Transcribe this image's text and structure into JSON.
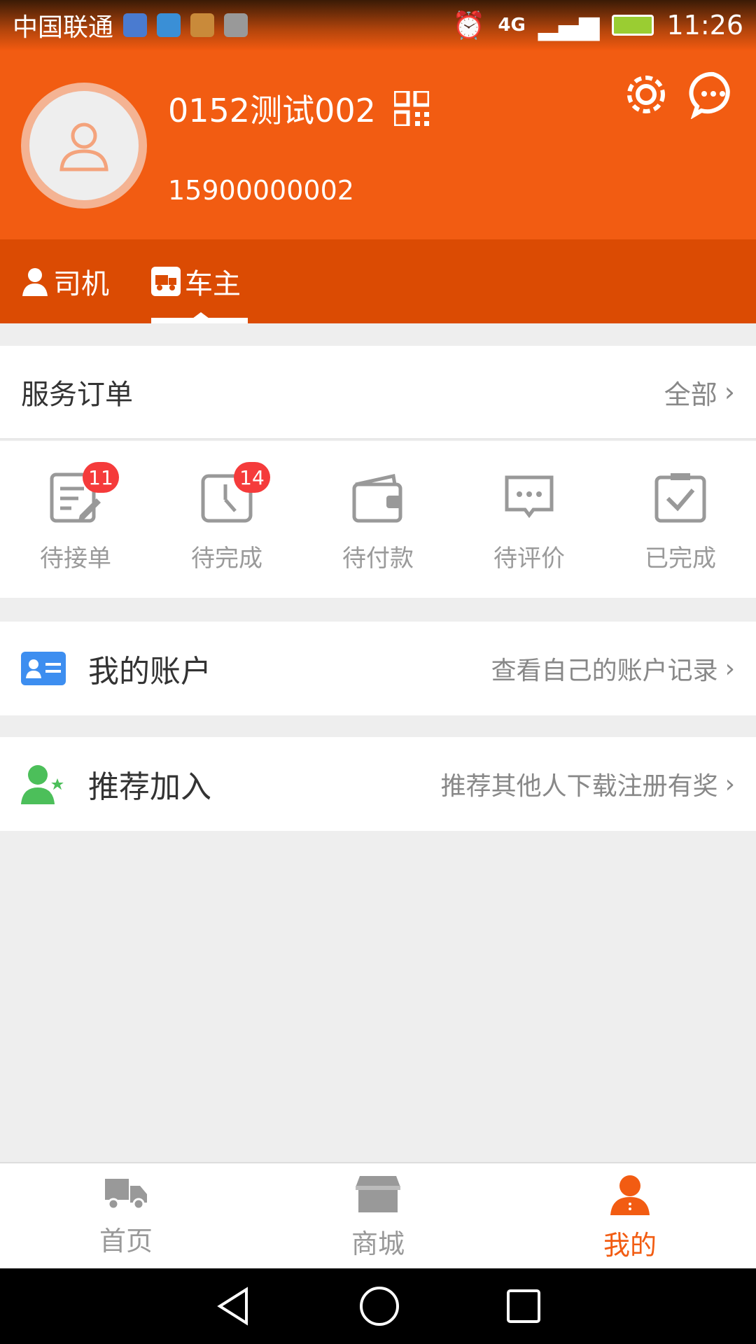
{
  "status_bar": {
    "carrier": "中国联通",
    "network": "4G",
    "time": "11:26"
  },
  "profile": {
    "username": "0152测试002",
    "phone": "15900000002"
  },
  "role_tabs": [
    {
      "label": "司机",
      "active": false
    },
    {
      "label": "车主",
      "active": true
    }
  ],
  "service_orders": {
    "title": "服务订单",
    "all_label": "全部",
    "items": [
      {
        "label": "待接单",
        "icon": "order-edit-icon",
        "badge": "11"
      },
      {
        "label": "待完成",
        "icon": "clock-icon",
        "badge": "14"
      },
      {
        "label": "待付款",
        "icon": "wallet-icon",
        "badge": null
      },
      {
        "label": "待评价",
        "icon": "comment-icon",
        "badge": null
      },
      {
        "label": "已完成",
        "icon": "clipboard-check-icon",
        "badge": null
      }
    ]
  },
  "account": {
    "title": "我的账户",
    "hint": "查看自己的账户记录"
  },
  "referral": {
    "title": "推荐加入",
    "hint": "推荐其他人下载注册有奖"
  },
  "bottom_nav": [
    {
      "label": "首页",
      "icon": "truck-icon",
      "active": false
    },
    {
      "label": "商城",
      "icon": "store-icon",
      "active": false
    },
    {
      "label": "我的",
      "icon": "person-icon",
      "active": true
    }
  ],
  "colors": {
    "brand": "#f25c12",
    "tab_bar": "#db4b03",
    "badge": "#f53b3b",
    "account_icon": "#3d8ef0",
    "referral_icon": "#4cbf5a"
  }
}
